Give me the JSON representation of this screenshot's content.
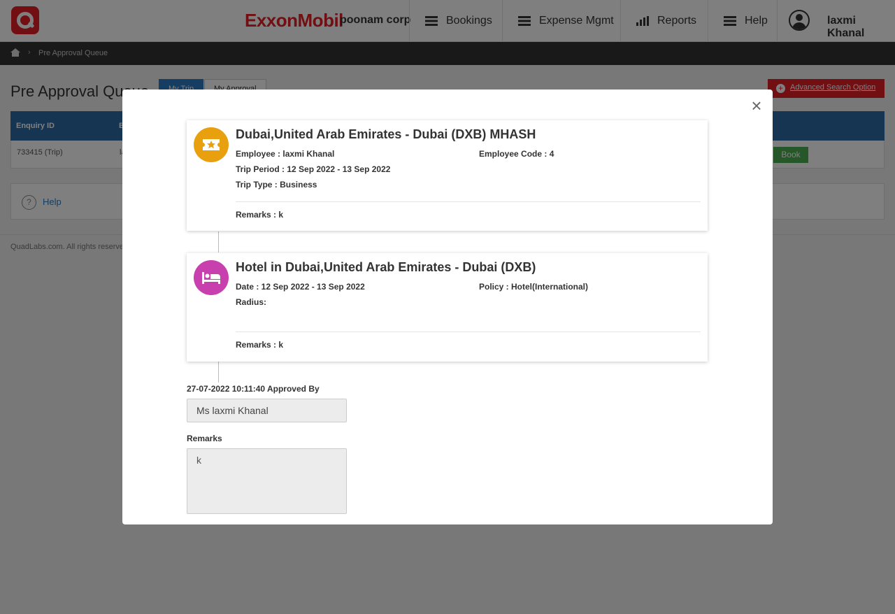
{
  "header": {
    "brand": "ExxonMobil",
    "corp": "poonam corp",
    "nav": [
      "Bookings",
      "Expense Mgmt",
      "Reports",
      "Help"
    ],
    "user": "laxmi Khanal"
  },
  "breadcrumb": {
    "current": "Pre Approval Queue"
  },
  "page": {
    "title": "Pre Approval Queue",
    "tabs": [
      "My Trip",
      "My Approval"
    ],
    "advanced_search": "Advanced Search Option",
    "table": {
      "headers": [
        "Enquiry ID",
        "E"
      ],
      "row": {
        "id": "733415 (Trip)",
        "col2": "la",
        "book": "Book"
      }
    },
    "help": "Help",
    "copyright": "QuadLabs.com. All rights reserve"
  },
  "modal": {
    "trip": {
      "title": "Dubai,United Arab Emirates - Dubai (DXB) MHASH",
      "employee": "Employee : laxmi Khanal",
      "employee_code": "Employee Code : 4",
      "period": "Trip Period : 12 Sep 2022 - 13 Sep 2022",
      "type": "Trip Type : Business",
      "remarks": "Remarks :  k"
    },
    "hotel": {
      "title": "Hotel in Dubai,United Arab Emirates - Dubai (DXB)",
      "date": "Date : 12 Sep 2022 - 13 Sep 2022",
      "policy": "Policy : Hotel(International)",
      "radius": "Radius:",
      "remarks": "Remarks : k"
    },
    "approval": {
      "line": "27-07-2022 10:11:40 Approved By",
      "approver": "Ms laxmi Khanal",
      "remarks_label": "Remarks",
      "remarks_value": "k"
    }
  },
  "colors": {
    "brand_red": "#e21e26",
    "trip_icon": "#e9a00e",
    "hotel_icon": "#c83fae",
    "header_blue": "#2d6aa5"
  },
  "icons": [
    "quadlabs-logo-icon",
    "menu-bars-icon",
    "reports-chart-icon",
    "user-avatar-icon",
    "home-icon",
    "ticket-star-icon",
    "bed-icon",
    "close-icon",
    "help-circle-icon",
    "plus-circle-icon"
  ]
}
